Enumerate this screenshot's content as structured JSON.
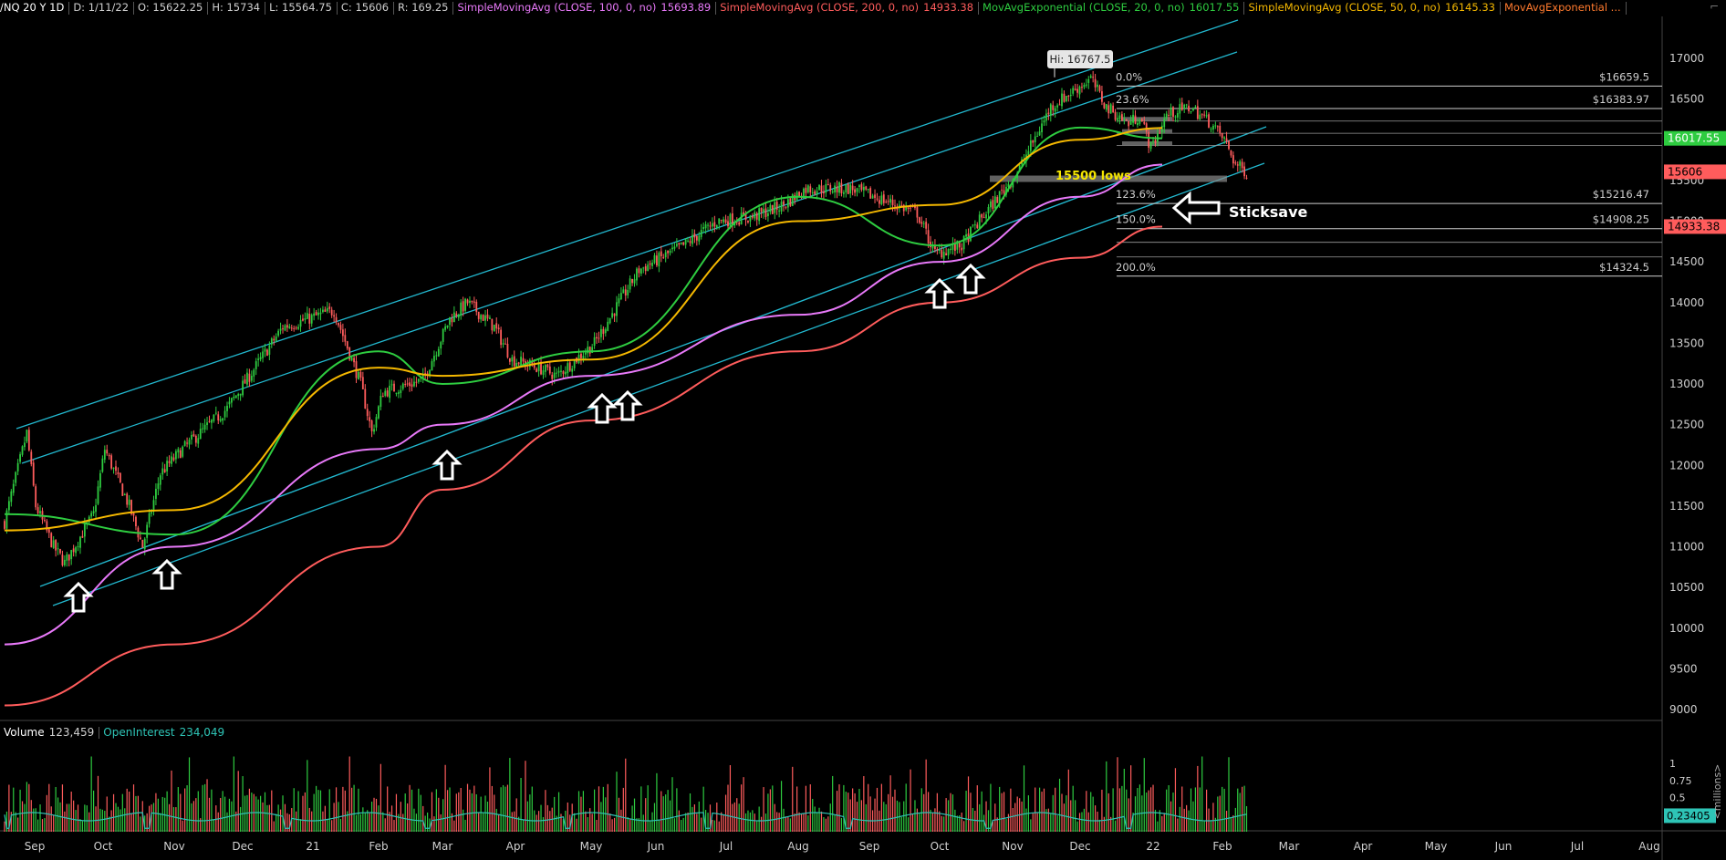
{
  "header": {
    "symbol": "/NQ 20 Y 1D",
    "date": "D: 1/11/22",
    "open": "O: 15622.25",
    "high": "H: 15734",
    "low": "L: 15564.75",
    "close": "C: 15606",
    "range": "R: 169.25",
    "studies": [
      {
        "label": "SimpleMovingAvg (CLOSE, 100, 0, no)",
        "value": "15693.89",
        "color": "#e879f9"
      },
      {
        "label": "SimpleMovingAvg (CLOSE, 200, 0, no)",
        "value": "14933.38",
        "color": "#ff5c5c"
      },
      {
        "label": "MovAvgExponential (CLOSE, 20, 0, no)",
        "value": "16017.55",
        "color": "#2ecc40"
      },
      {
        "label": "SimpleMovingAvg (CLOSE, 50, 0, no)",
        "value": "16145.33",
        "color": "#f5b800"
      },
      {
        "label": "MovAvgExponential ...",
        "value": "",
        "color": "#ff7a2e"
      }
    ]
  },
  "volume_header": {
    "volume_label": "Volume",
    "volume_value": "123,459",
    "oi_label": "OpenInterest",
    "oi_value": "234,049"
  },
  "annotations": {
    "hi_label": "Hi: 16767.5",
    "lows_label": "15500 lows",
    "sticksave_label": "Sticksave"
  },
  "colors": {
    "background": "#000000",
    "channel": "#22b8cf",
    "sma100": "#e879f9",
    "sma200": "#ff5c5c",
    "ema20": "#2ecc40",
    "sma50": "#f5b800",
    "candle_up": "#2ecc40",
    "candle_down": "#ff5c5c",
    "open_interest": "#2ec4b6",
    "fib": "#cfcfcf"
  },
  "chart_data": [
    {
      "type": "line",
      "title": "/NQ 20 Y 1D",
      "x_ticks": [
        "Sep",
        "Oct",
        "Nov",
        "Dec",
        "21",
        "Feb",
        "Mar",
        "Apr",
        "May",
        "Jun",
        "Jul",
        "Aug",
        "Sep",
        "Oct",
        "Nov",
        "Dec",
        "22",
        "Feb",
        "Mar",
        "Apr",
        "May",
        "Jun",
        "Jul",
        "Aug"
      ],
      "y_ticks": [
        9000,
        9500,
        10000,
        10500,
        11000,
        11500,
        12000,
        12500,
        13000,
        13500,
        14000,
        14500,
        15000,
        15500,
        16000,
        16500,
        17000
      ],
      "ylim": [
        8900,
        17450
      ],
      "price_labels": [
        {
          "value": 16017.55,
          "text": "16017.55",
          "color": "#2ecc40"
        },
        {
          "value": 15606,
          "text": "15606",
          "color": "#ff5c5c"
        },
        {
          "value": 14933.38,
          "text": "14933.38",
          "color": "#ff5c5c"
        }
      ],
      "series": [
        {
          "name": "SimpleMovingAvg (CLOSE, 100, 0, no)",
          "x": [
            "Sep",
            "Nov",
            "Feb",
            "Mar",
            "May",
            "Aug",
            "Oct",
            "Dec",
            "22"
          ],
          "values": [
            9800,
            11000,
            12200,
            12500,
            13100,
            13850,
            14500,
            15300,
            15694
          ]
        },
        {
          "name": "SimpleMovingAvg (CLOSE, 200, 0, no)",
          "x": [
            "Sep",
            "Nov",
            "Feb",
            "Mar",
            "May",
            "Aug",
            "Oct",
            "Dec",
            "22"
          ],
          "values": [
            9050,
            9800,
            11000,
            11700,
            12550,
            13400,
            14000,
            14550,
            14933
          ]
        },
        {
          "name": "MovAvgExponential (CLOSE, 20, 0, no)",
          "x": [
            "Sep",
            "Nov",
            "Feb",
            "Mar",
            "May",
            "Aug",
            "Oct",
            "Dec",
            "22"
          ],
          "values": [
            11400,
            11150,
            13400,
            13000,
            13400,
            15300,
            14700,
            16150,
            16018
          ]
        },
        {
          "name": "SimpleMovingAvg (CLOSE, 50, 0, no)",
          "x": [
            "Sep",
            "Nov",
            "Feb",
            "Mar",
            "May",
            "Aug",
            "Oct",
            "Dec",
            "22"
          ],
          "values": [
            11200,
            11450,
            13200,
            13100,
            13300,
            15000,
            15200,
            16000,
            16145
          ]
        }
      ],
      "fib_levels": [
        {
          "pct": "0.0%",
          "price": "$16659.5",
          "value": 16659.5
        },
        {
          "pct": "23.6%",
          "price": "$16383.97",
          "value": 16383.97
        },
        {
          "pct": "123.6%",
          "price": "$15216.47",
          "value": 15216.47
        },
        {
          "pct": "150.0%",
          "price": "$14908.25",
          "value": 14908.25
        },
        {
          "pct": "200.0%",
          "price": "$14324.5",
          "value": 14324.5
        }
      ],
      "hi": 16767.5
    },
    {
      "type": "bar",
      "title": "Volume",
      "y_ticks": [
        "1",
        "0.75",
        "0.5",
        "0.25"
      ],
      "ylabel": "<millions>",
      "current_value_label": "0.23405",
      "last_value": 0.23405
    }
  ]
}
